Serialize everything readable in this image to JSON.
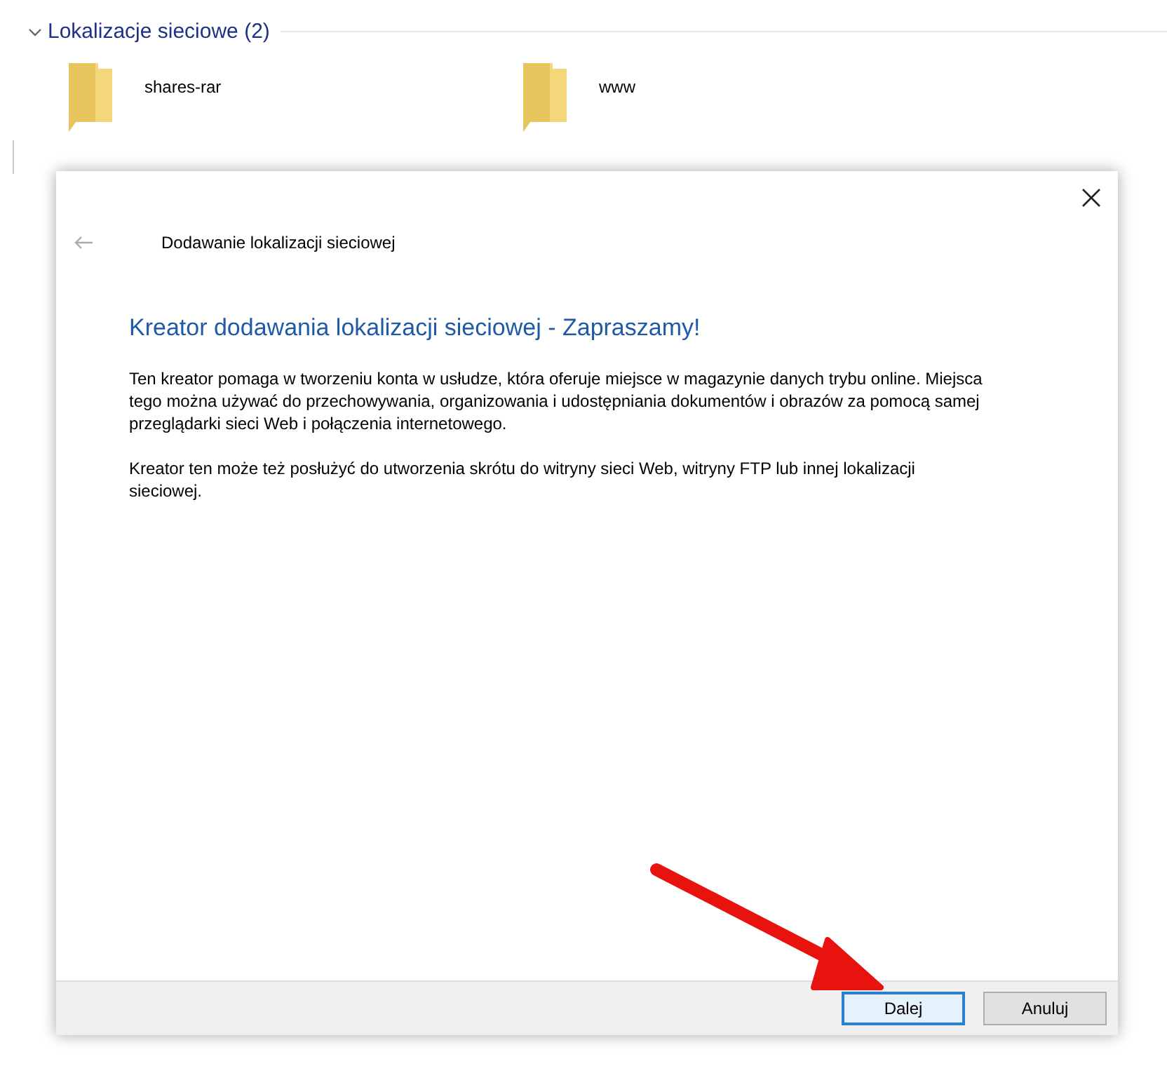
{
  "group": {
    "title": "Lokalizacje sieciowe (2)",
    "expanded": true,
    "items": [
      {
        "name": "shares-rar"
      },
      {
        "name": "www"
      }
    ]
  },
  "dialog": {
    "title": "Dodawanie lokalizacji sieciowej",
    "heading": "Kreator dodawania lokalizacji sieciowej - Zapraszamy!",
    "paragraphs": [
      "Ten kreator pomaga w tworzeniu konta w usłudze, która oferuje miejsce w magazynie danych trybu online. Miejsca tego można używać do przechowywania, organizowania i udostępniania dokumentów i obrazów za pomocą samej przeglądarki sieci Web i połączenia internetowego.",
      "Kreator ten może też posłużyć do utworzenia skrótu do witryny sieci Web, witryny FTP  lub innej lokalizacji sieciowej."
    ],
    "buttons": [
      {
        "label": "Dalej",
        "selected": true
      },
      {
        "label": "Anuluj",
        "selected": false
      }
    ]
  }
}
